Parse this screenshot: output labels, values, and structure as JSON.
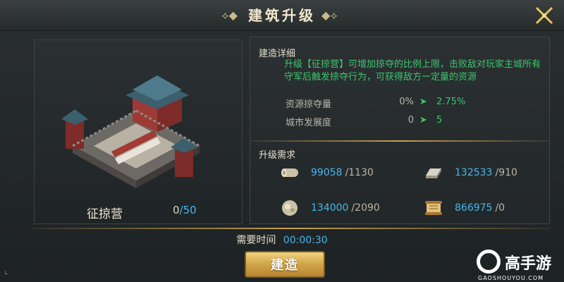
{
  "window": {
    "title": "建筑升级"
  },
  "building": {
    "name": "征掠营",
    "count_current": "0",
    "count_max": "/50"
  },
  "details": {
    "heading": "建造详细",
    "description": "升级【征掠营】可增加掠夺的比例上限，击败敌对玩家主城所有守军后触发掠夺行为，可获得敌方一定量的资源",
    "stats": [
      {
        "label": "资源掠夺量",
        "from": "0%",
        "to": "2.75%"
      },
      {
        "label": "城市发展度",
        "from": "0",
        "to": "5"
      }
    ]
  },
  "requirements": {
    "heading": "升级需求",
    "items": [
      {
        "icon": "wood-icon",
        "have": "99058",
        "need": "/1130"
      },
      {
        "icon": "iron-ingot-icon",
        "have": "132533",
        "need": "/910"
      },
      {
        "icon": "stone-icon",
        "have": "134000",
        "need": "/2090"
      },
      {
        "icon": "scroll-icon",
        "have": "866975",
        "need": "/0"
      }
    ]
  },
  "footer": {
    "time_label": "需要时间",
    "time_value": "00:00:30",
    "build_label": "建造"
  },
  "watermark": {
    "brand": "高手游",
    "domain": "GAOSHOUYOU.COM"
  },
  "colors": {
    "accent_blue": "#4ab6ea",
    "accent_green": "#3cc66e",
    "gold": "#c6a253"
  }
}
